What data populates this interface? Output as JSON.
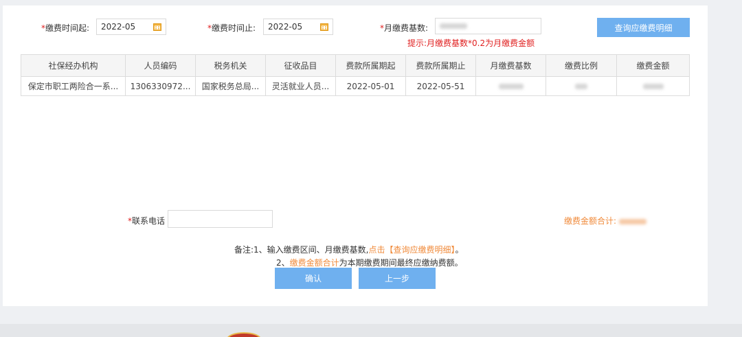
{
  "filters": {
    "start_label": "缴费时间起:",
    "start_value": "2022-05",
    "end_label": "缴费时间止:",
    "end_value": "2022-05",
    "base_label": "月缴费基数:",
    "hint": "提示:月缴费基数*0.2为月缴费金额",
    "query_button": "查询应缴费明细",
    "required_mark": "*"
  },
  "table": {
    "columns": [
      "社保经办机构",
      "人员编码",
      "税务机关",
      "征收品目",
      "费款所属期起",
      "费款所属期止",
      "月缴费基数",
      "缴费比例",
      "缴费金额"
    ],
    "rows": [
      {
        "agency": "保定市职工两险合一系...",
        "person_code": "1306330972...",
        "tax_office": "国家税务总局...",
        "item": "灵活就业人员...",
        "period_start": "2022-05-01",
        "period_end": "2022-05-51"
      }
    ]
  },
  "contact": {
    "label": "联系电话",
    "required_mark": "*",
    "value": ""
  },
  "total": {
    "label": "缴费金额合计:"
  },
  "notes": {
    "line1_prefix": "备注:1、输入缴费区间、月缴费基数,",
    "line1_link": "点击【查询应缴费明细】",
    "line1_suffix": "。",
    "line2_prefix": "2、",
    "line2_link": "缴费金额合计",
    "line2_suffix": "为本期缴费期间最终应缴纳费额。"
  },
  "actions": {
    "confirm": "确认",
    "back": "上一步"
  },
  "colors": {
    "accent": "#6fb0ef",
    "required": "#e02020",
    "highlight": "#f08a3a"
  },
  "icons": {
    "calendar": "calendar-icon"
  }
}
